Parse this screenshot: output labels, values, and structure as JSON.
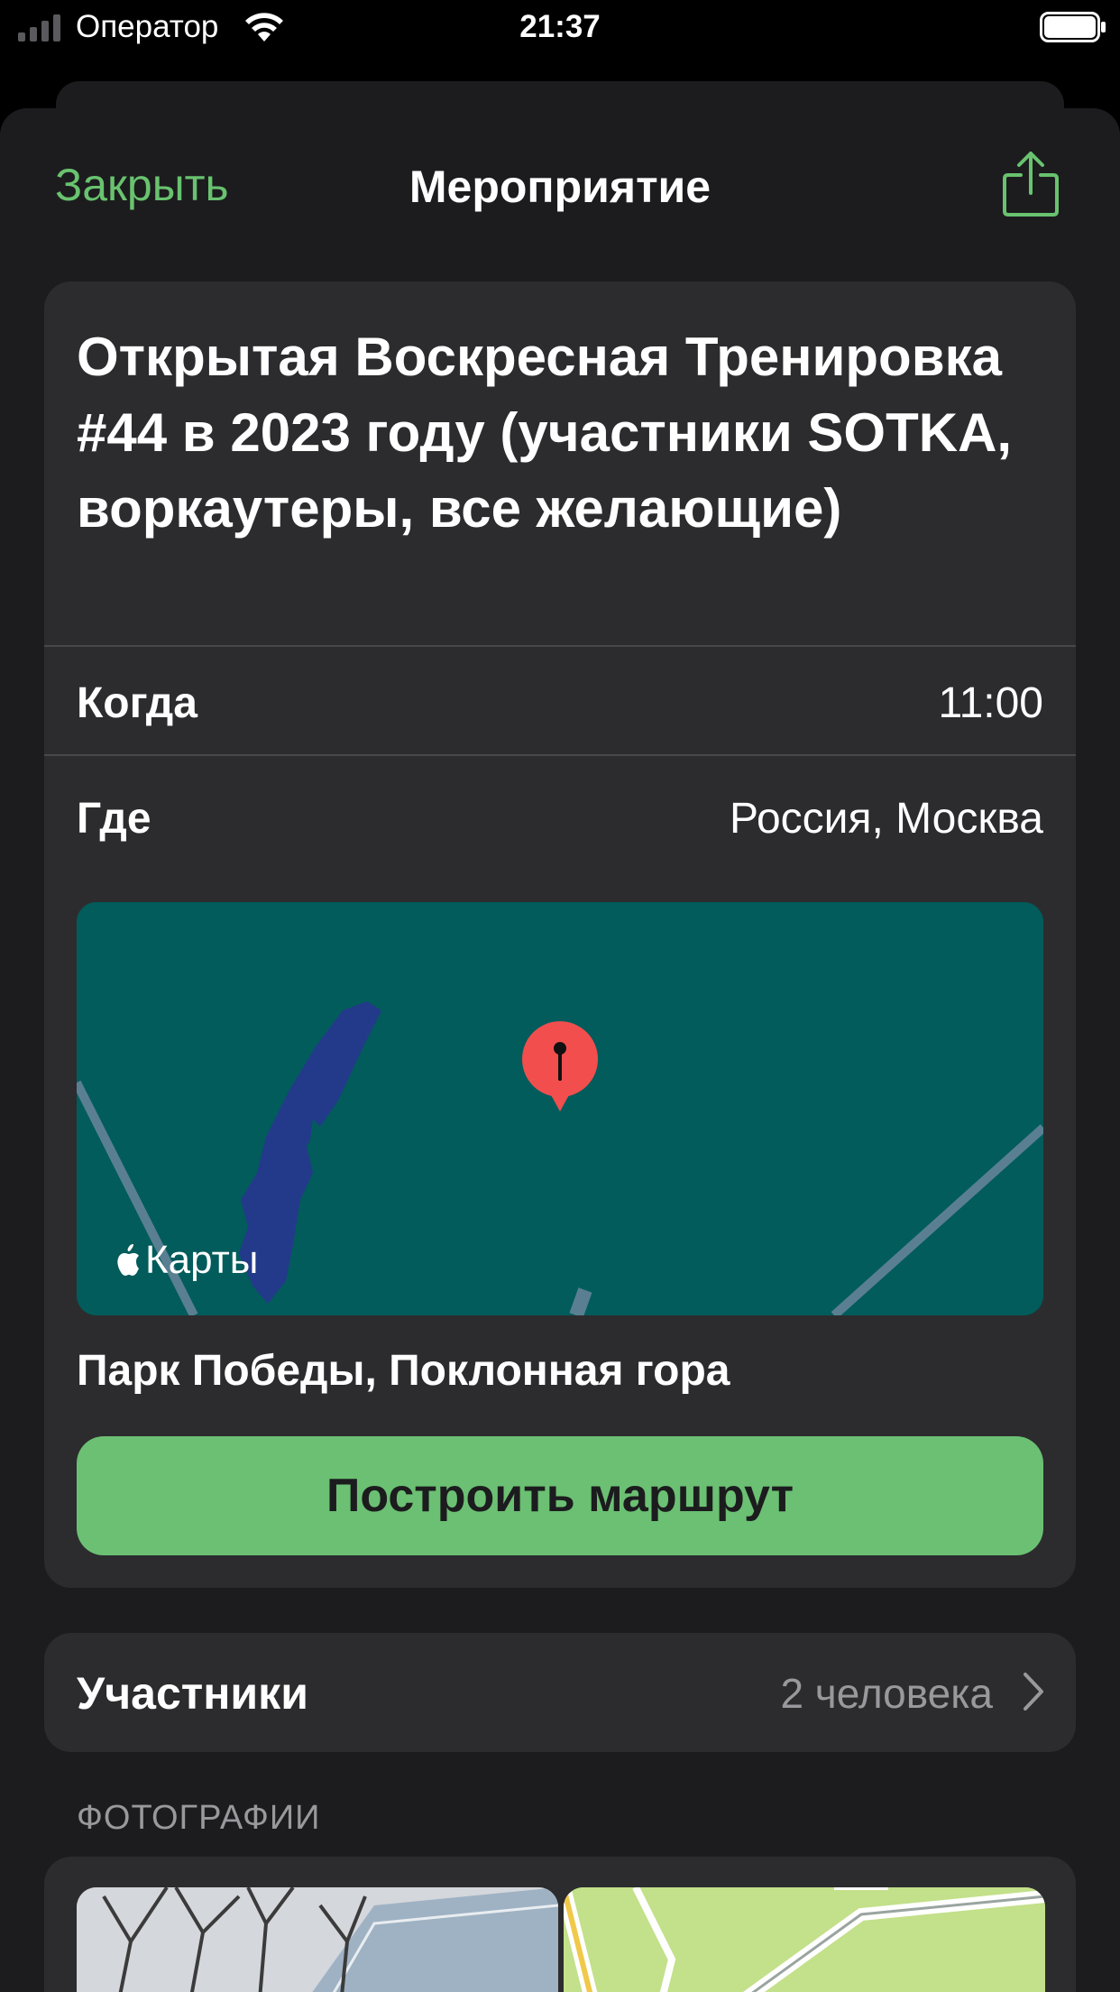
{
  "status_bar": {
    "carrier": "Оператор",
    "time": "21:37"
  },
  "nav": {
    "close_label": "Закрыть",
    "title": "Мероприятие",
    "share_icon": "share-icon"
  },
  "event": {
    "title": "Открытая Воскресная Тренировка #44 в 2023 году (участники SOTKA, воркаутеры, все желающие)",
    "when_label": "Когда",
    "when_value": "11:00",
    "where_label": "Где",
    "where_value": "Россия, Москва",
    "map_logo": "Карты",
    "place_name": "Парк Победы, Поклонная гора",
    "route_button": "Построить маршрут"
  },
  "participants": {
    "label": "Участники",
    "count": "2 человека"
  },
  "photos": {
    "section_title": "ФОТОГРАФИИ"
  },
  "colors": {
    "accent": "#69c26f",
    "button": "#6bc073",
    "card": "#2c2c2e",
    "map_water": "#025c5b",
    "pin": "#f24e4e"
  }
}
